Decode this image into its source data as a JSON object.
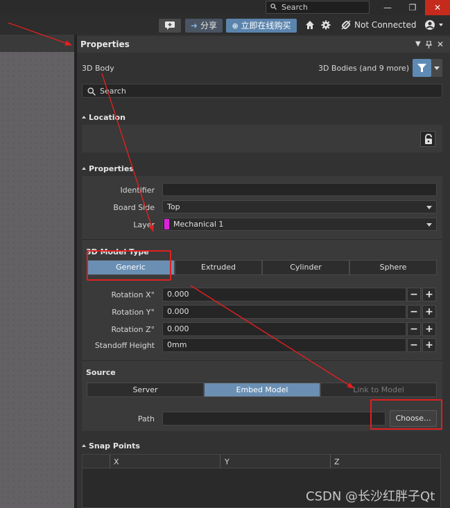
{
  "titlebar": {
    "search_label": "Search",
    "minimize_glyph": "—",
    "restore_glyph": "❐",
    "close_glyph": "✕"
  },
  "toolbar": {
    "share_label": "分享",
    "buy_label": "立即在线购买",
    "connection_label": "Not Connected"
  },
  "panel": {
    "title": "Properties",
    "object_type": "3D Body",
    "filter_label": "3D Bodies (and 9 more)",
    "search_placeholder": "Search"
  },
  "location": {
    "section_title": "Location"
  },
  "properties": {
    "section_title": "Properties",
    "identifier_label": "Identifier",
    "identifier_value": "",
    "board_side_label": "Board Side",
    "board_side_value": "Top",
    "layer_label": "Layer",
    "layer_value": "Mechanical 1",
    "layer_color": "#e020e0"
  },
  "model_type": {
    "title": "3D Model Type",
    "options": [
      "Generic",
      "Extruded",
      "Cylinder",
      "Sphere"
    ],
    "selected": "Generic"
  },
  "rotation": {
    "x_label": "Rotation X°",
    "x_value": "0.000",
    "y_label": "Rotation Y°",
    "y_value": "0.000",
    "z_label": "Rotation Z°",
    "z_value": "0.000",
    "standoff_label": "Standoff Height",
    "standoff_value": "0mm",
    "minus": "−",
    "plus": "+"
  },
  "source": {
    "title": "Source",
    "options": [
      "Server",
      "Embed Model",
      "Link to Model"
    ],
    "selected": "Embed Model",
    "path_label": "Path",
    "path_value": "",
    "choose_label": "Choose..."
  },
  "snap_points": {
    "section_title": "Snap Points",
    "columns": [
      "X",
      "Y",
      "Z"
    ]
  },
  "watermark": "CSDN @长沙红胖子Qt",
  "colors": {
    "accent": "#6a8fb3",
    "annotation_red": "#e02020",
    "close_red": "#c42b1c"
  }
}
